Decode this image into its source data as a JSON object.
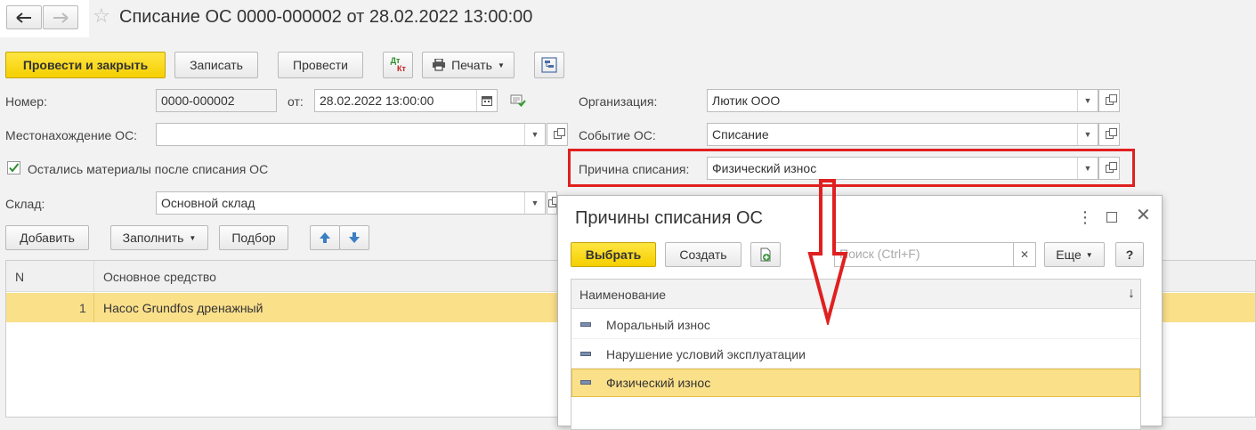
{
  "window": {
    "title": "Списание ОС 0000-000002 от 28.02.2022 13:00:00"
  },
  "toolbar": {
    "post_close": "Провести и закрыть",
    "save": "Записать",
    "post": "Провести",
    "dtkt_top": "Дт",
    "dtkt_bottom": "Кт",
    "print": "Печать"
  },
  "form": {
    "number_label": "Номер:",
    "number_value": "0000-000002",
    "date_label": "от:",
    "date_value": "28.02.2022 13:00:00",
    "location_label": "Местонахождение ОС:",
    "location_value": "",
    "materials_label": "Остались материалы после списания ОС",
    "materials_checked": true,
    "warehouse_label": "Склад:",
    "warehouse_value": "Основной склад",
    "org_label": "Организация:",
    "org_value": "Лютик ООО",
    "event_label": "Событие ОС:",
    "event_value": "Списание",
    "reason_label": "Причина списания:",
    "reason_value": "Физический износ"
  },
  "table_toolbar": {
    "add": "Добавить",
    "fill": "Заполнить",
    "pick": "Подбор"
  },
  "table": {
    "columns": [
      "N",
      "Основное средство"
    ],
    "rows": [
      {
        "n": "1",
        "asset": "Насос Grundfos дренажный"
      }
    ]
  },
  "dialog": {
    "title": "Причины списания ОС",
    "select": "Выбрать",
    "create": "Создать",
    "search_placeholder": "Поиск (Ctrl+F)",
    "more": "Еще",
    "help": "?",
    "column": "Наименование",
    "sort_indicator": "↓",
    "items": [
      {
        "label": "Моральный износ",
        "selected": false
      },
      {
        "label": "Нарушение условий эксплуатации",
        "selected": false
      },
      {
        "label": "Физический износ",
        "selected": true
      }
    ]
  },
  "colors": {
    "accent_yellow": "#f5cf00",
    "selection": "#fbe08a",
    "highlight_red": "#e02020",
    "background": "#f2f2f2"
  }
}
